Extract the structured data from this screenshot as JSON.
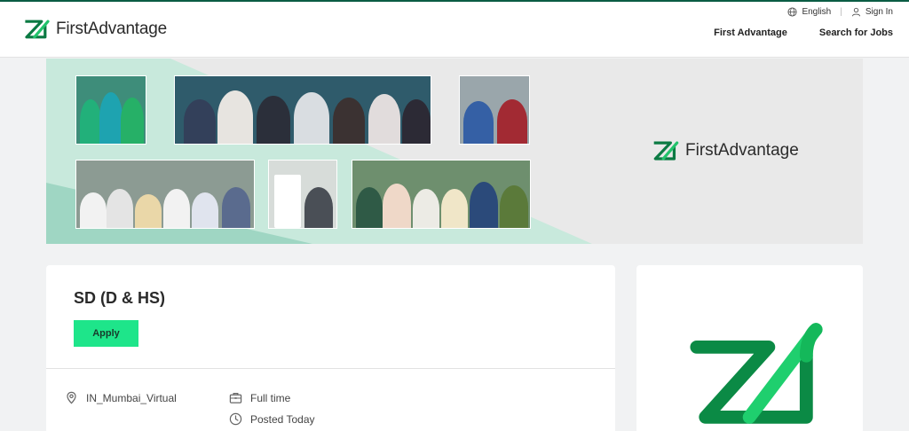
{
  "header": {
    "brand": "FirstAdvantage",
    "language": "English",
    "sign_in": "Sign In",
    "nav": [
      "First Advantage",
      "Search for Jobs"
    ]
  },
  "banner": {
    "brand": "FirstAdvantage"
  },
  "job": {
    "title": "SD (D & HS)",
    "apply_label": "Apply",
    "location": "IN_Mumbai_Virtual",
    "employment_type": "Full time",
    "posted": "Posted Today"
  },
  "icons": {
    "language": "globe-icon",
    "sign_in": "user-icon",
    "location": "map-pin-icon",
    "employment_type": "briefcase-icon",
    "posted": "clock-icon"
  },
  "colors": {
    "brand_green": "#11a957",
    "brand_dark_green": "#0b7a43",
    "apply_green": "#1ee58a",
    "banner_teal": "#c8e9dc"
  }
}
